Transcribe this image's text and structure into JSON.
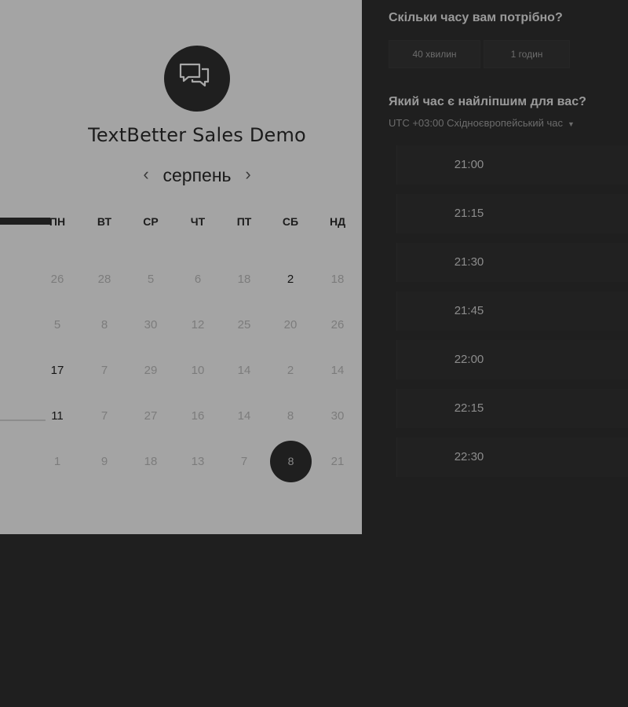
{
  "calendar": {
    "title": "TextBetter Sales Demo",
    "month": "серпень",
    "prev_icon": "chevron-left-icon",
    "next_icon": "chevron-right-icon",
    "weekdays": [
      "ПН",
      "ВТ",
      "СР",
      "ЧТ",
      "ПТ",
      "СБ",
      "НД"
    ],
    "weeks": [
      [
        "26",
        "28",
        "5",
        "6",
        "18",
        "2",
        "18"
      ],
      [
        "5",
        "8",
        "30",
        "12",
        "25",
        "20",
        "26"
      ],
      [
        "17",
        "7",
        "29",
        "10",
        "14",
        "2",
        "14"
      ],
      [
        "11",
        "7",
        "27",
        "16",
        "14",
        "8",
        "30"
      ],
      [
        "1",
        "9",
        "18",
        "13",
        "7",
        "8",
        "21"
      ]
    ],
    "logo_icon": "chat-bubbles-icon"
  },
  "scheduler": {
    "duration_question": "Скільки часу вам потрібно?",
    "durations": [
      "40 хвилин",
      "1 годин"
    ],
    "time_question": "Який час є найліпшим для вас?",
    "timezone": "UTC +03:00 Східноєвропейський час",
    "slots": [
      "21:00",
      "21:15",
      "21:30",
      "21:45",
      "22:00",
      "22:15",
      "22:30"
    ]
  },
  "colors": {
    "panel_bg": "#a4a4a4",
    "page_bg": "#1f1f1f",
    "accent": "#1f1f1f"
  }
}
